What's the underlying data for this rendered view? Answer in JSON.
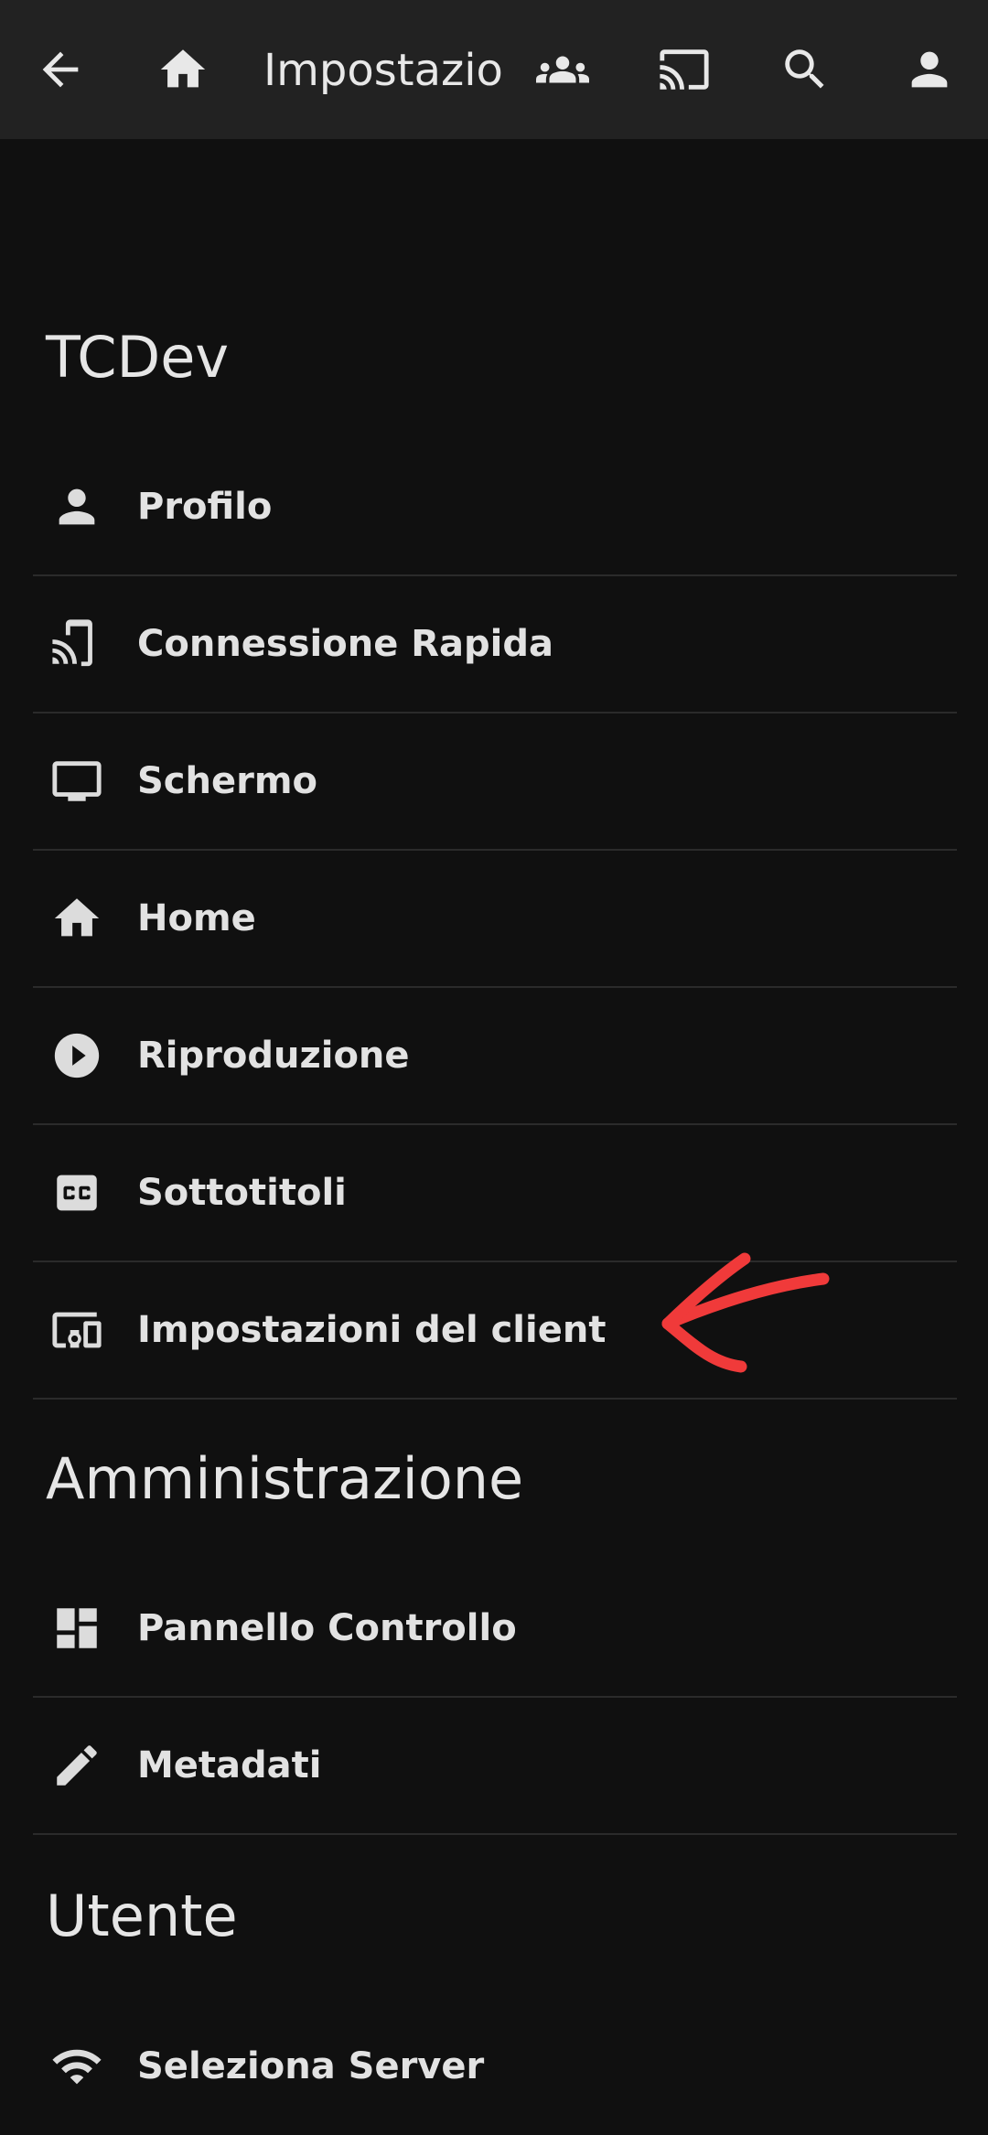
{
  "header": {
    "title": "Impostazioni",
    "icons": [
      "back-arrow-icon",
      "home-icon",
      "group-icon",
      "cast-icon",
      "search-icon",
      "account-icon"
    ]
  },
  "sections": [
    {
      "title": "TCDev",
      "items": [
        {
          "label": "Profilo",
          "icon": "person-icon"
        },
        {
          "label": "Connessione Rapida",
          "icon": "cast-connect-icon"
        },
        {
          "label": "Schermo",
          "icon": "monitor-icon"
        },
        {
          "label": "Home",
          "icon": "home-icon"
        },
        {
          "label": "Riproduzione",
          "icon": "play-circle-icon"
        },
        {
          "label": "Sottotitoli",
          "icon": "closed-caption-icon"
        },
        {
          "label": "Impostazioni del client",
          "icon": "devices-icon"
        }
      ]
    },
    {
      "title": "Amministrazione",
      "items": [
        {
          "label": "Pannello Controllo",
          "icon": "dashboard-icon"
        },
        {
          "label": "Metadati",
          "icon": "edit-icon"
        }
      ]
    },
    {
      "title": "Utente",
      "items": [
        {
          "label": "Seleziona Server",
          "icon": "wifi-icon"
        }
      ]
    }
  ],
  "annotation": {
    "color": "#f03a3a",
    "shape": "arrow-pointing-left"
  }
}
